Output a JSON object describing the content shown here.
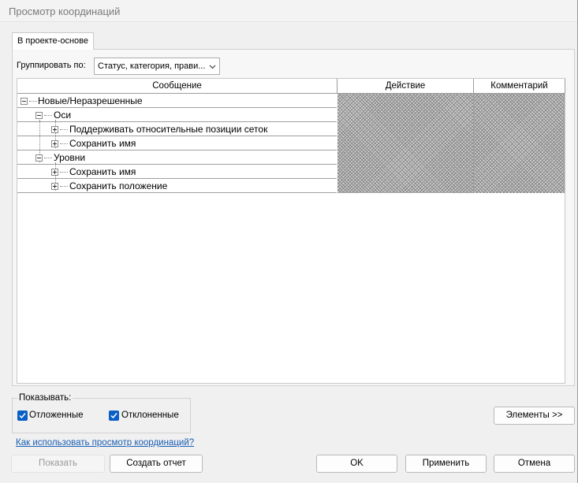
{
  "window": {
    "title": "Просмотр координаций"
  },
  "tabs": [
    {
      "label": "В проекте-основе",
      "selected": true
    }
  ],
  "group_by": {
    "label": "Группировать по:",
    "value": "Статус, категория, прави..."
  },
  "grid": {
    "columns": [
      "Сообщение",
      "Действие",
      "Комментарий"
    ],
    "rows": [
      {
        "label": "Новые/Неразрешенные",
        "level": 0,
        "expanded": true
      },
      {
        "label": "Оси",
        "level": 1,
        "expanded": true
      },
      {
        "label": "Поддерживать относительные позиции сеток",
        "level": 2,
        "expanded": false
      },
      {
        "label": "Сохранить имя",
        "level": 2,
        "expanded": false
      },
      {
        "label": "Уровни",
        "level": 1,
        "expanded": true
      },
      {
        "label": "Сохранить имя",
        "level": 2,
        "expanded": false
      },
      {
        "label": "Сохранить положение",
        "level": 2,
        "expanded": false
      }
    ]
  },
  "show": {
    "label": "Показывать:",
    "options": [
      {
        "label": "Отложенные",
        "checked": true
      },
      {
        "label": "Отклоненные",
        "checked": true
      }
    ]
  },
  "help_link": "Как использовать просмотр координаций?",
  "buttons": {
    "elements": "Элементы >>",
    "show": "Показать",
    "create_report": "Создать отчет",
    "ok": "OK",
    "apply": "Применить",
    "cancel": "Отмена"
  },
  "colors": {
    "accent": "#0a5fc4",
    "link": "#1a5fb4"
  }
}
